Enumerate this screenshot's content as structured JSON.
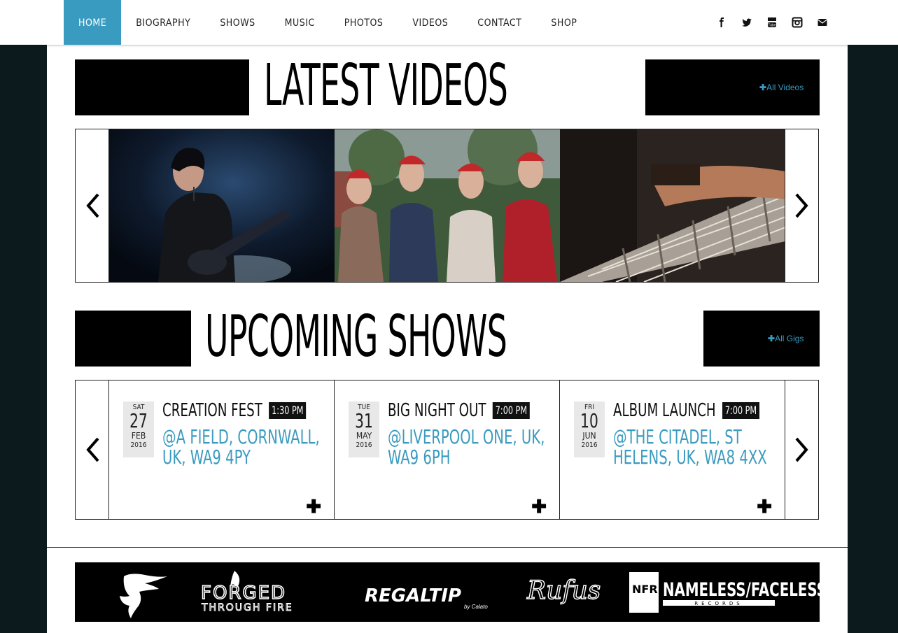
{
  "nav": {
    "items": [
      {
        "label": "HOME",
        "active": true
      },
      {
        "label": "BIOGRAPHY"
      },
      {
        "label": "SHOWS"
      },
      {
        "label": "MUSIC"
      },
      {
        "label": "PHOTOS"
      },
      {
        "label": "VIDEOS"
      },
      {
        "label": "CONTACT"
      },
      {
        "label": "SHOP"
      }
    ],
    "social_icons": [
      "facebook-icon",
      "twitter-icon",
      "youtube-icon",
      "instagram-icon",
      "envelope-icon"
    ]
  },
  "videos": {
    "title": "LATEST VIDEOS",
    "all_link": "All Videos",
    "thumbnails": [
      "guitarist-performing",
      "band-christmas-jumpers",
      "guitar-fretboard-closeup"
    ]
  },
  "shows": {
    "title": "UPCOMING SHOWS",
    "all_link": "All Gigs",
    "items": [
      {
        "dow": "SAT",
        "day": "27",
        "month": "FEB",
        "year": "2016",
        "title": "CREATION FEST",
        "time": "1:30 PM",
        "venue": "@A FIELD, CORNWALL, UK, WA9 4PY"
      },
      {
        "dow": "TUE",
        "day": "31",
        "month": "MAY",
        "year": "2016",
        "title": "BIG NIGHT OUT",
        "time": "7:00 PM",
        "venue": "@LIVERPOOL ONE, UK, WA9 6PH"
      },
      {
        "dow": "FRI",
        "day": "10",
        "month": "JUN",
        "year": "2016",
        "title": "ALBUM LAUNCH",
        "time": "7:00 PM",
        "venue": "@THE CITADEL, ST HELENS, UK, WA8 4XX"
      }
    ]
  },
  "sponsors": {
    "forged": "FORGED THROUGH FIRE",
    "regal": "REGALTIP",
    "regal_sub": "by Calato",
    "rufus": "Rufus",
    "nfr": "NFR",
    "nameless": "NAMELESS/FACELESS",
    "records": "RECORDS"
  },
  "colors": {
    "accent": "#3a9bc0",
    "bg": "#0c1a1d"
  }
}
